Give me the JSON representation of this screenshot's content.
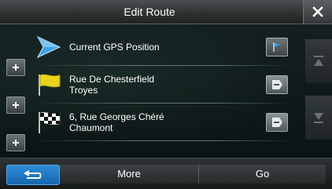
{
  "header": {
    "title": "Edit Route",
    "close_icon": "close-icon"
  },
  "route": {
    "items": [
      {
        "icon": "current-position-arrow-icon",
        "line1": "Current GPS Position",
        "line2": "",
        "action_icon": "flag-icon"
      },
      {
        "icon": "yellow-flag-icon",
        "line1": "Rue De Chesterfield",
        "line2": "Troyes",
        "action_icon": "remove-icon"
      },
      {
        "icon": "checkered-flag-icon",
        "line1": "6, Rue Georges Chéré",
        "line2": "Chaumont",
        "action_icon": "remove-icon"
      }
    ]
  },
  "footer": {
    "back_icon": "back-arrow-icon",
    "more_label": "More",
    "go_label": "Go"
  },
  "colors": {
    "accent": "#2377c6",
    "background": "#0d1212",
    "position_arrow": "#3ea1e8",
    "waypoint_flag": "#e8d21a"
  }
}
